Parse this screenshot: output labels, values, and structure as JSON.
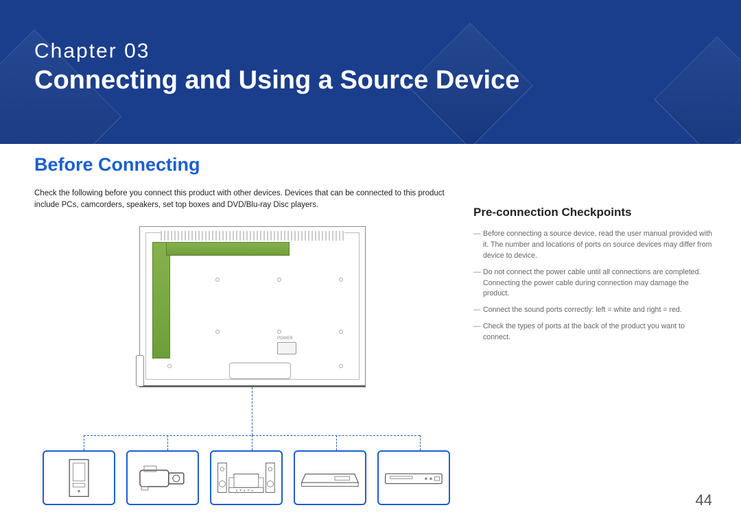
{
  "chapter": {
    "label": "Chapter  03",
    "title": "Connecting and Using a Source Device"
  },
  "section_heading": "Before Connecting",
  "intro_text": "Check the following before you connect this product with other devices. Devices that can be connected to this product include PCs, camcorders, speakers, set top boxes and DVD/Blu-ray Disc players.",
  "sub_heading": "Pre-connection Checkpoints",
  "checkpoints": [
    "Before connecting a source device, read the user manual provided with it. The number and locations of ports on source devices may differ from device to device.",
    "Do not connect the power cable until all connections are completed. Connecting the power cable during connection may damage the product.",
    "Connect the sound ports correctly: left = white and right = red.",
    "Check the types of ports at the back of the product you want to connect."
  ],
  "devices": [
    {
      "name": "pc-tower"
    },
    {
      "name": "camcorder"
    },
    {
      "name": "speaker-system"
    },
    {
      "name": "set-top-box"
    },
    {
      "name": "disc-player"
    }
  ],
  "page_number": "44"
}
